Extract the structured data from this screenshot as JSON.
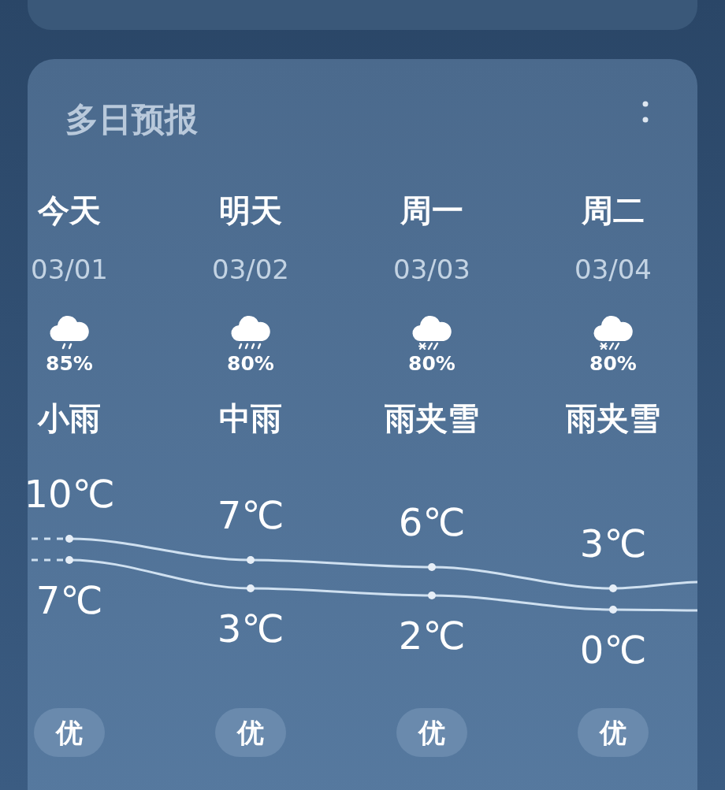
{
  "card": {
    "title": "多日预报"
  },
  "days": [
    {
      "name": "今天",
      "date": "03/01",
      "kind": "rain-light",
      "chance": "85%",
      "weather": "小雨",
      "high": "10℃",
      "low": "7℃",
      "air": "优"
    },
    {
      "name": "明天",
      "date": "03/02",
      "kind": "rain-moderate",
      "chance": "80%",
      "weather": "中雨",
      "high": "7℃",
      "low": "3℃",
      "air": "优"
    },
    {
      "name": "周一",
      "date": "03/03",
      "kind": "sleet",
      "chance": "80%",
      "weather": "雨夹雪",
      "high": "6℃",
      "low": "2℃",
      "air": "优"
    },
    {
      "name": "周二",
      "date": "03/04",
      "kind": "sleet",
      "chance": "80%",
      "weather": "雨夹雪",
      "high": "3℃",
      "low": "0℃",
      "air": "优"
    }
  ]
}
